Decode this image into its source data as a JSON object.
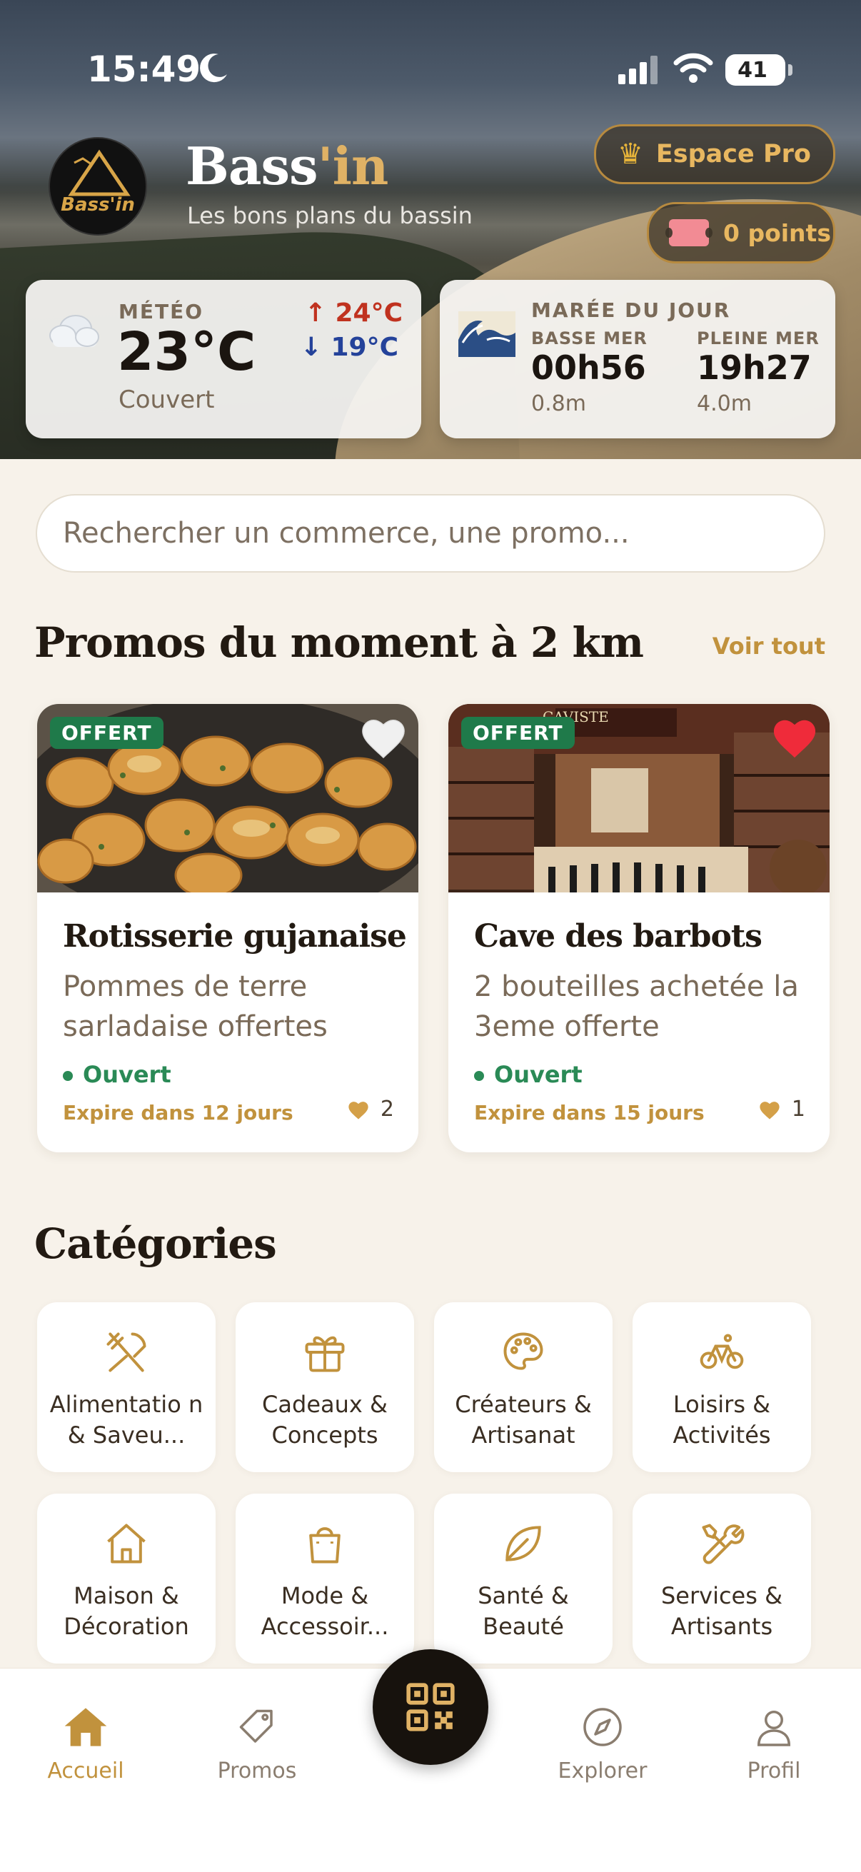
{
  "status_bar": {
    "time": "15:49",
    "battery": "41"
  },
  "header": {
    "brand_main": "Bass",
    "brand_accent": "'in",
    "tagline": "Les bons plans du bassin",
    "logo_text": "Bass'in",
    "pro_button": "Espace Pro",
    "points_button": "0 points"
  },
  "weather": {
    "label": "MÉTÉO",
    "temp": "23°C",
    "condition": "Couvert",
    "high": "↑ 24°C",
    "low": "↓ 19°C"
  },
  "tide": {
    "label": "MARÉE DU JOUR",
    "low_label": "BASSE MER",
    "low_time": "00h56",
    "low_height": "0.8m",
    "high_label": "PLEINE MER",
    "high_time": "19h27",
    "high_height": "4.0m"
  },
  "search": {
    "placeholder": "Rechercher un commerce, une promo..."
  },
  "promos": {
    "title": "Promos du moment à 2 km",
    "see_all": "Voir tout",
    "items": [
      {
        "badge": "OFFERT",
        "name": "Rotisserie gujanaise",
        "desc": "Pommes de terre sarladaise offertes",
        "status": "Ouvert",
        "expires": "Expire dans 12 jours",
        "likes": "2",
        "favorite": false
      },
      {
        "badge": "OFFERT",
        "name": "Cave des barbots",
        "desc": "2 bouteilles achetée la 3eme offerte",
        "status": "Ouvert",
        "expires": "Expire dans 15 jours",
        "likes": "1",
        "favorite": true,
        "shop_sign": "CAVISTE"
      }
    ]
  },
  "categories": {
    "title": "Catégories",
    "items": [
      {
        "label": "Alimentatio n & Saveu...",
        "icon": "utensils-icon"
      },
      {
        "label": "Cadeaux & Concepts",
        "icon": "gift-icon"
      },
      {
        "label": "Créateurs & Artisanat",
        "icon": "palette-icon"
      },
      {
        "label": "Loisirs & Activités",
        "icon": "bike-icon"
      },
      {
        "label": "Maison & Décoration",
        "icon": "house-icon"
      },
      {
        "label": "Mode & Accessoir...",
        "icon": "bag-icon"
      },
      {
        "label": "Santé & Beauté",
        "icon": "leaf-icon"
      },
      {
        "label": "Services & Artisants",
        "icon": "tools-icon"
      }
    ]
  },
  "tabbar": {
    "home": "Accueil",
    "promos": "Promos",
    "explore": "Explorer",
    "profile": "Profil"
  },
  "colors": {
    "accent": "#c1923d",
    "open_green": "#2a8a56",
    "badge_green": "#1f7a4a",
    "background": "#f7f2ea"
  }
}
